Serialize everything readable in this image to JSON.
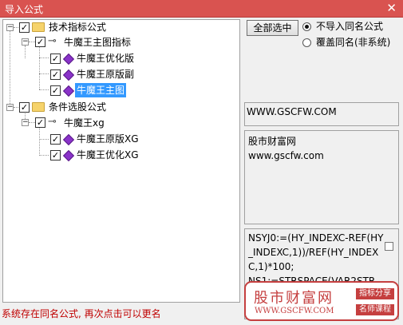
{
  "window": {
    "title": "导入公式",
    "close_glyph": "✕"
  },
  "tree": {
    "group1": {
      "label": "技术指标公式",
      "formula": {
        "label": "牛魔王主图指标",
        "items": [
          {
            "label": "牛魔王优化版"
          },
          {
            "label": "牛魔王原版副"
          },
          {
            "label": "牛魔王主图",
            "selected": true
          }
        ]
      }
    },
    "group2": {
      "label": "条件选股公式",
      "formula": {
        "label": "牛魔王xg",
        "items": [
          {
            "label": "牛魔王原版XG"
          },
          {
            "label": "牛魔王优化XG"
          }
        ]
      }
    }
  },
  "options": {
    "select_all_label": "全部选中",
    "radio_no_import": "不导入同名公式",
    "radio_overwrite": "覆盖同名(非系统)",
    "selected_radio": "radio_no_import"
  },
  "panel": {
    "url_text": "WWW.GSCFW.COM",
    "info_line1": "股市财富网",
    "info_line2": "www.gscfw.com",
    "code_text": "NSYJ0:=(HY_INDEXC-REF(HY_INDEXC,1))/REF(HY_INDEXC,1)*100;\nNS1:=STRSPACE(VAR2STR"
  },
  "logo": {
    "brand": "股市财富网",
    "url": "WWW.GSCFW.COM",
    "tag1": "指标分享",
    "tag2": "名师课程"
  },
  "status": {
    "message": "系统存在同名公式, 再次点击可以更名"
  },
  "colors": {
    "title_bar": "#d95350",
    "selection": "#3399ff",
    "status_text": "#c00000",
    "brand": "#c53f3f"
  },
  "check_glyph": "✓",
  "expander_glyph": "−"
}
